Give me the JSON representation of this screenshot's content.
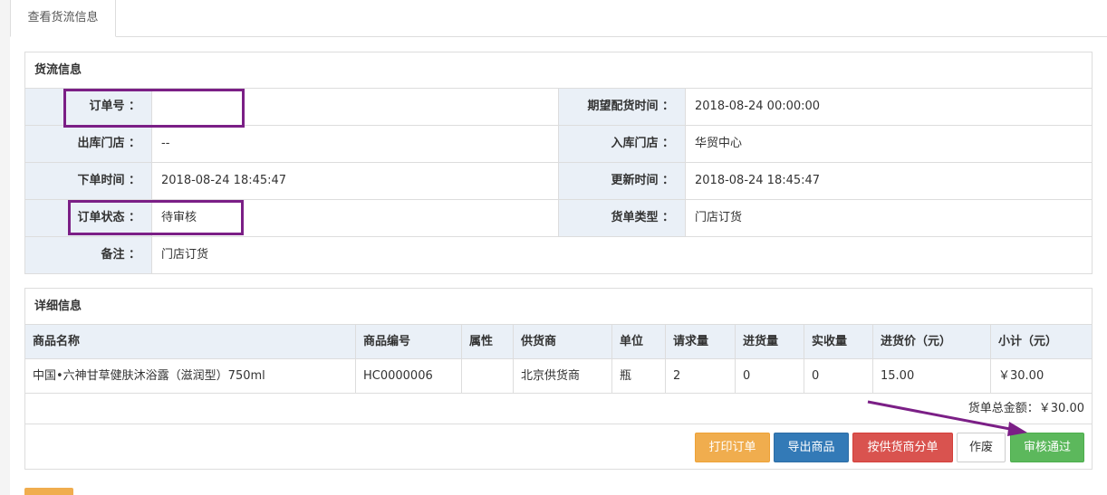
{
  "tab": {
    "label": "查看货流信息"
  },
  "info": {
    "title": "货流信息",
    "rows": [
      {
        "left_label": "订单号 ：",
        "left_value": "",
        "right_label": "期望配货时间 ：",
        "right_value": "2018-08-24 00:00:00"
      },
      {
        "left_label": "出库门店 ：",
        "left_value": "--",
        "right_label": "入库门店 ：",
        "right_value": "华贸中心"
      },
      {
        "left_label": "下单时间 ：",
        "left_value": "2018-08-24 18:45:47",
        "right_label": "更新时间 ：",
        "right_value": "2018-08-24 18:45:47"
      },
      {
        "left_label": "订单状态 ：",
        "left_value": "待审核",
        "right_label": "货单类型 ：",
        "right_value": "门店订货"
      },
      {
        "left_label": "备注 ：",
        "left_value": "门店订货"
      }
    ]
  },
  "detail": {
    "title": "详细信息",
    "columns": [
      "商品名称",
      "商品编号",
      "属性",
      "供货商",
      "单位",
      "请求量",
      "进货量",
      "实收量",
      "进货价（元）",
      "小计（元）"
    ],
    "rows": [
      [
        "中国•六神甘草健肤沐浴露（滋润型）750ml",
        "HC0000006",
        "",
        "北京供货商",
        "瓶",
        "2",
        "0",
        "0",
        "15.00",
        "￥30.00"
      ]
    ],
    "total": "货单总金额：￥30.00"
  },
  "actions": {
    "print": "打印订单",
    "export": "导出商品",
    "split": "按供货商分单",
    "void": "作废",
    "approve": "审核通过"
  },
  "colors": {
    "highlight": "#7b1f86",
    "label_bg": "#eaf0f7",
    "print": "#f0ad4e",
    "export": "#337ab7",
    "split": "#d9534f",
    "approve": "#5cb85c"
  }
}
